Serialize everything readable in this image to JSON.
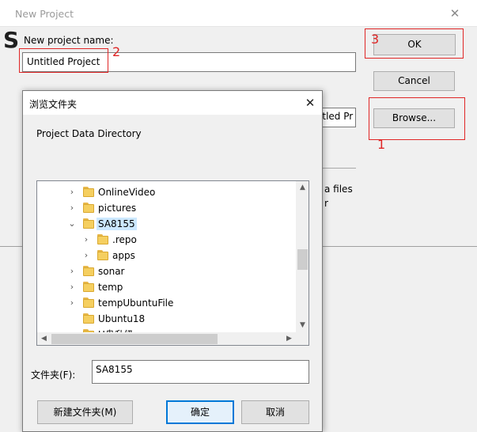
{
  "new_project": {
    "title": "New Project",
    "close_symbol": "✕",
    "background_letter": "S",
    "name_label": "New project name:",
    "name_value": "Untitled Project",
    "dir_field_tail": "ltitled Pr",
    "text_files": "a files",
    "text_r": "r",
    "ok_label": "OK",
    "cancel_label": "Cancel",
    "browse_label": "Browse..."
  },
  "annotations": {
    "num_1": "1",
    "num_2": "2",
    "num_3": "3",
    "color": "#e02626"
  },
  "browse_dialog": {
    "title": "浏览文件夹",
    "close_symbol": "✕",
    "description": "Project Data Directory",
    "tree": [
      {
        "label": "OnlineVideo",
        "level": 0,
        "expander": "›",
        "selected": false
      },
      {
        "label": "pictures",
        "level": 0,
        "expander": "›",
        "selected": false
      },
      {
        "label": "SA8155",
        "level": 0,
        "expander": "⌄",
        "selected": true
      },
      {
        "label": ".repo",
        "level": 1,
        "expander": "›",
        "selected": false
      },
      {
        "label": "apps",
        "level": 1,
        "expander": "›",
        "selected": false
      },
      {
        "label": "sonar",
        "level": 0,
        "expander": "›",
        "selected": false
      },
      {
        "label": "temp",
        "level": 0,
        "expander": "›",
        "selected": false
      },
      {
        "label": "tempUbuntuFile",
        "level": 0,
        "expander": "›",
        "selected": false
      },
      {
        "label": "Ubuntu18",
        "level": 0,
        "expander": "",
        "selected": false
      },
      {
        "label": "U盘升级",
        "level": 0,
        "expander": "",
        "selected": false
      }
    ],
    "scroll_symbols": {
      "up": "▲",
      "down": "▼",
      "left": "◀",
      "right": "▶"
    },
    "folder_label": "文件夹(F):",
    "folder_value": "SA8155",
    "new_folder_label": "新建文件夹(M)",
    "confirm_label": "确定",
    "cancel_label": "取消",
    "accent_color": "#0078d7",
    "selection_color": "#cce8ff"
  }
}
